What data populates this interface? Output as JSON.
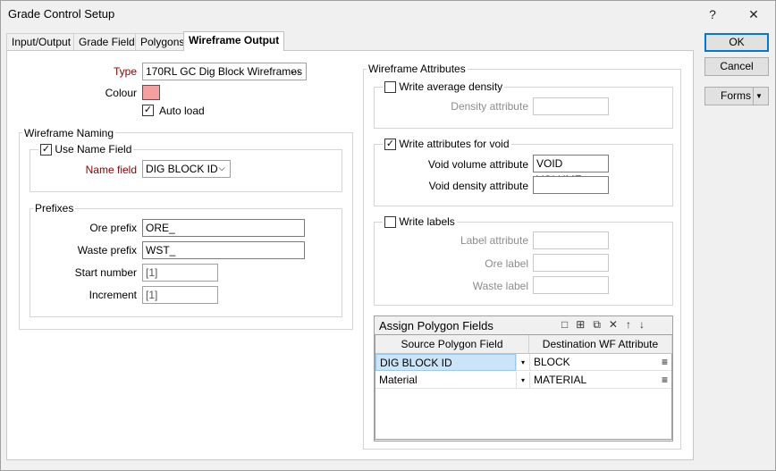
{
  "window": {
    "title": "Grade Control Setup",
    "help": "?",
    "close": "✕"
  },
  "tabs": [
    "Input/Output",
    "Grade Fields",
    "Polygons",
    "Wireframe Output"
  ],
  "buttons": {
    "ok": "OK",
    "cancel": "Cancel",
    "forms": "Forms"
  },
  "main": {
    "type_label": "Type",
    "type_value": "170RL GC Dig Block Wireframes",
    "type_browse": "...",
    "colour_label": "Colour",
    "colour_value": "#f4a0a0",
    "autoload_label": "Auto load",
    "autoload_checked": "✓"
  },
  "naming": {
    "title": "Wireframe Naming",
    "use_name_field_label": "Use Name Field",
    "use_name_field_checked": "✓",
    "name_field_label": "Name field",
    "name_field_value": "DIG BLOCK ID",
    "prefixes_title": "Prefixes",
    "ore_prefix_label": "Ore prefix",
    "ore_prefix_value": "ORE_",
    "waste_prefix_label": "Waste prefix",
    "waste_prefix_value": "WST_",
    "start_number_label": "Start number",
    "start_number_value": "[1]",
    "increment_label": "Increment",
    "increment_value": "[1]"
  },
  "attributes": {
    "title": "Wireframe Attributes",
    "write_avg_density_label": "Write average density",
    "density_attribute_label": "Density attribute",
    "write_void_label": "Write attributes for void",
    "write_void_checked": "✓",
    "void_volume_label": "Void volume attribute",
    "void_volume_value": "VOID VOLUME",
    "void_density_label": "Void density attribute",
    "void_density_value": "",
    "write_labels_label": "Write labels",
    "label_attribute_label": "Label attribute",
    "ore_label_label": "Ore label",
    "waste_label_label": "Waste label"
  },
  "assign": {
    "title": "Assign Polygon Fields",
    "col_source": "Source Polygon Field",
    "col_dest": "Destination WF Attribute",
    "rows": [
      {
        "source": "DIG BLOCK ID",
        "dest": "BLOCK"
      },
      {
        "source": "Material",
        "dest": "MATERIAL"
      }
    ]
  }
}
